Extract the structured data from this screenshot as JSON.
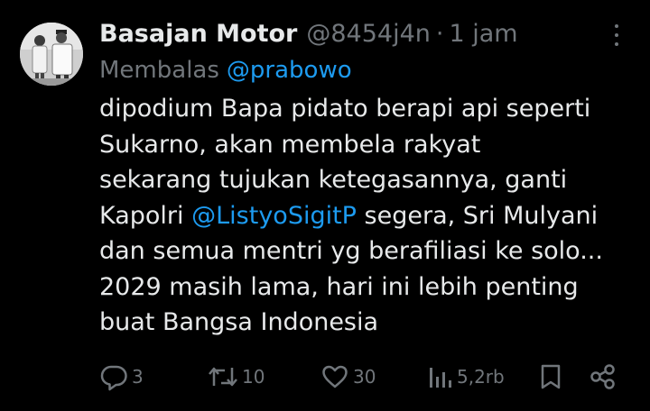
{
  "tweet": {
    "author_name": "Basajan Motor",
    "author_handle": "@8454j4n",
    "separator": "·",
    "time": "1 jam",
    "reply_prefix": "Membalas",
    "reply_mention": "@prabowo",
    "body_line_1": "dipodium Bapa pidato berapi api seperti",
    "body_line_2": "Sukarno, akan membela rakyat",
    "body_line_3": "sekarang tujukan ketegasannya, ganti",
    "body_line_4_pre": "Kapolri ",
    "body_line_4_mention": "@ListyoSigitP",
    "body_line_4_post": " segera, Sri Mulyani",
    "body_line_5": "dan semua mentri yg berafiliasi ke solo...",
    "body_line_6": "2029 masih lama, hari ini lebih penting",
    "body_line_7": "buat Bangsa Indonesia"
  },
  "actions": {
    "replies": "3",
    "reposts": "10",
    "likes": "30",
    "views": "5,2rb"
  },
  "colors": {
    "background": "#000000",
    "text": "#e7e9ea",
    "muted": "#71767b",
    "link": "#1d9bf0"
  },
  "icons": [
    "avatar-photo",
    "more-icon",
    "reply-icon",
    "repost-icon",
    "like-icon",
    "views-icon",
    "bookmark-icon",
    "share-icon"
  ]
}
